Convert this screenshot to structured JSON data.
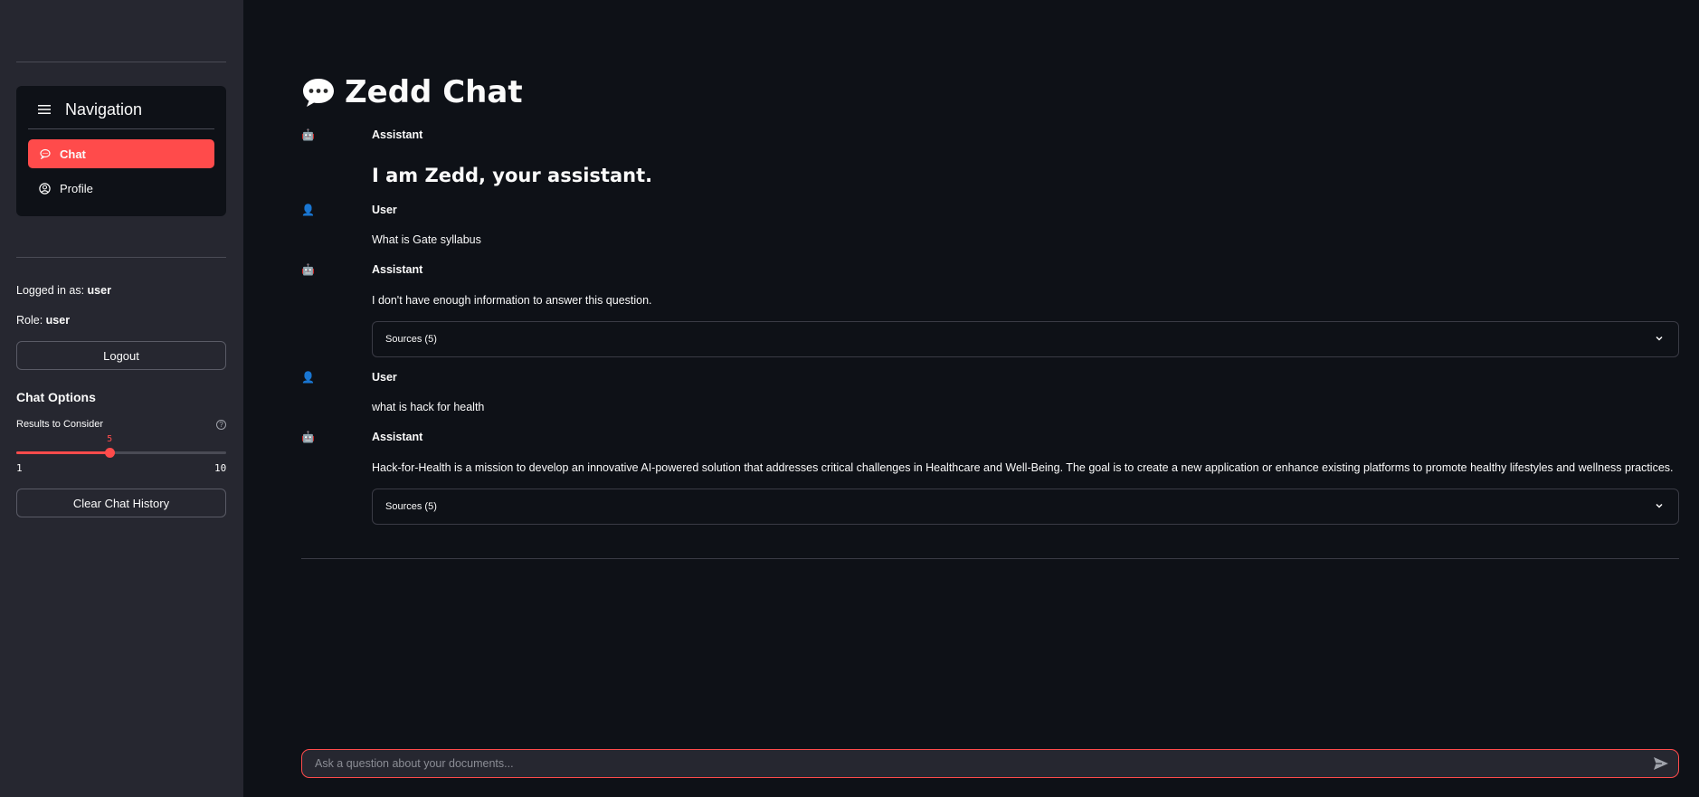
{
  "sidebar": {
    "nav_title": "Navigation",
    "nav_items": [
      {
        "label": "Chat",
        "icon": "chat-bubble-icon",
        "active": true
      },
      {
        "label": "Profile",
        "icon": "user-circle-icon",
        "active": false
      }
    ],
    "logged_in_label": "Logged in as: ",
    "logged_in_user": "user",
    "role_label": "Role: ",
    "role_value": "user",
    "logout_label": "Logout",
    "chat_options_title": "Chat Options",
    "slider": {
      "label": "Results to Consider",
      "value": "5",
      "min": "1",
      "max": "10"
    },
    "clear_label": "Clear Chat History"
  },
  "main": {
    "title": "Zedd Chat",
    "title_icon": "speech-bubble-icon",
    "messages": [
      {
        "role": "Assistant",
        "icon": "robot-icon",
        "text": "I am Zedd, your assistant."
      },
      {
        "role": "User",
        "icon": "user-icon",
        "text": "What is Gate syllabus"
      },
      {
        "role": "Assistant",
        "icon": "robot-icon",
        "text": "I don't have enough information to answer this question.",
        "sources": "Sources (5)"
      },
      {
        "role": "User",
        "icon": "user-icon",
        "text": "what is hack for health"
      },
      {
        "role": "Assistant",
        "icon": "robot-icon",
        "text": "Hack-for-Health is a mission to develop an innovative AI-powered solution that addresses critical challenges in Healthcare and Well-Being. The goal is to create a new application or enhance existing platforms to promote healthy lifestyles and wellness practices.",
        "sources": "Sources (5)"
      }
    ],
    "chat_input_placeholder": "Ask a question about your documents..."
  },
  "colors": {
    "accent": "#ff4b4b",
    "background": "#0e1117",
    "sidebar": "#262730"
  }
}
